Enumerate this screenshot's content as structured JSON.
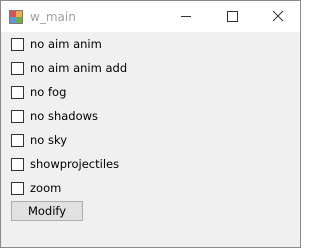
{
  "window": {
    "title": "w_main",
    "icon": "winforms-app-icon",
    "title_color": "#a0a0a0",
    "controls": [
      "minimize-icon",
      "maximize-icon",
      "close-icon"
    ]
  },
  "checkboxes": [
    {
      "label": "no aim anim",
      "checked": false
    },
    {
      "label": "no aim anim add",
      "checked": false
    },
    {
      "label": "no fog",
      "checked": false
    },
    {
      "label": "no shadows",
      "checked": false
    },
    {
      "label": "no sky",
      "checked": false
    },
    {
      "label": "showprojectiles",
      "checked": false
    },
    {
      "label": "zoom",
      "checked": false
    }
  ],
  "modify_button": {
    "label": "Modify"
  }
}
